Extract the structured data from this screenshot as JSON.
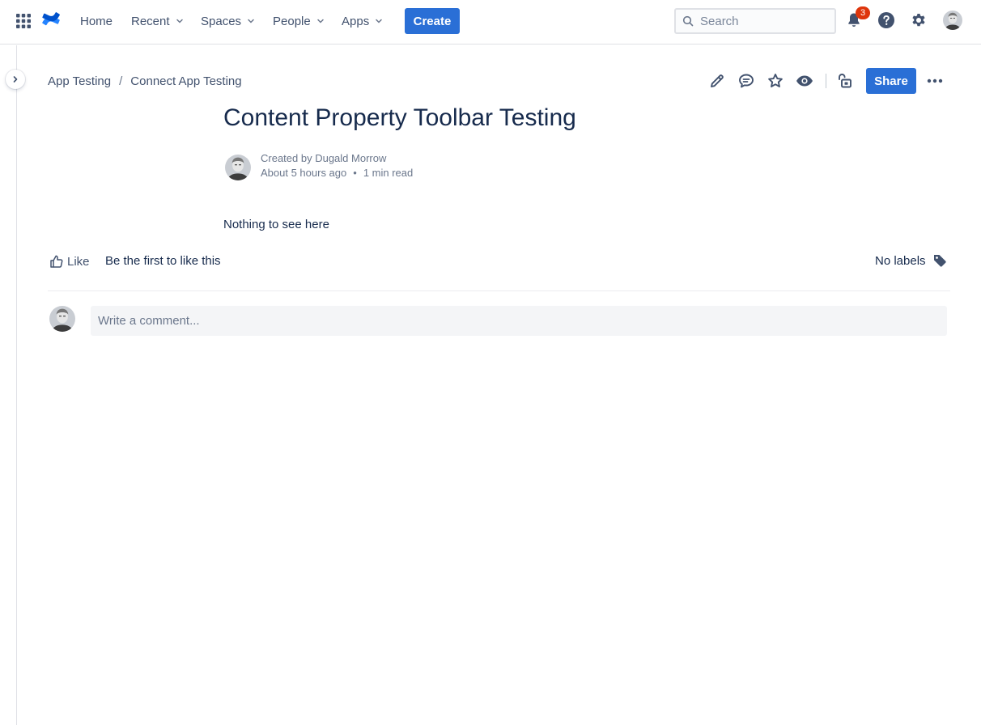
{
  "nav": {
    "items": [
      {
        "label": "Home",
        "has_dropdown": false
      },
      {
        "label": "Recent",
        "has_dropdown": true
      },
      {
        "label": "Spaces",
        "has_dropdown": true
      },
      {
        "label": "People",
        "has_dropdown": true
      },
      {
        "label": "Apps",
        "has_dropdown": true
      }
    ],
    "create_label": "Create",
    "search_placeholder": "Search",
    "notification_count": "3",
    "icons": [
      "app-switcher-icon",
      "confluence-logo-icon",
      "notification-bell-icon",
      "help-icon",
      "settings-gear-icon"
    ]
  },
  "breadcrumb": {
    "items": [
      "App Testing",
      "Connect App Testing"
    ],
    "separator": "/"
  },
  "toolbar": {
    "share_label": "Share",
    "icons": [
      "edit-pencil-icon",
      "comment-icon",
      "star-icon",
      "watch-eye-icon",
      "restrictions-lock-icon",
      "more-actions-icon"
    ]
  },
  "page": {
    "title": "Content Property Toolbar Testing",
    "created_by": "Created by Dugald Morrow",
    "time_ago": "About 5 hours ago",
    "read_time": "1 min read",
    "separator": "•",
    "body": "Nothing to see here"
  },
  "social": {
    "like_label": "Like",
    "like_text": "Be the first to like this",
    "labels_text": "No labels"
  },
  "comment": {
    "placeholder": "Write a comment..."
  },
  "colors": {
    "primary": "#2a6fd6",
    "text": "#172b4d",
    "subtle_text": "#42526e",
    "badge": "#de350b",
    "logo": "#2684ff"
  }
}
